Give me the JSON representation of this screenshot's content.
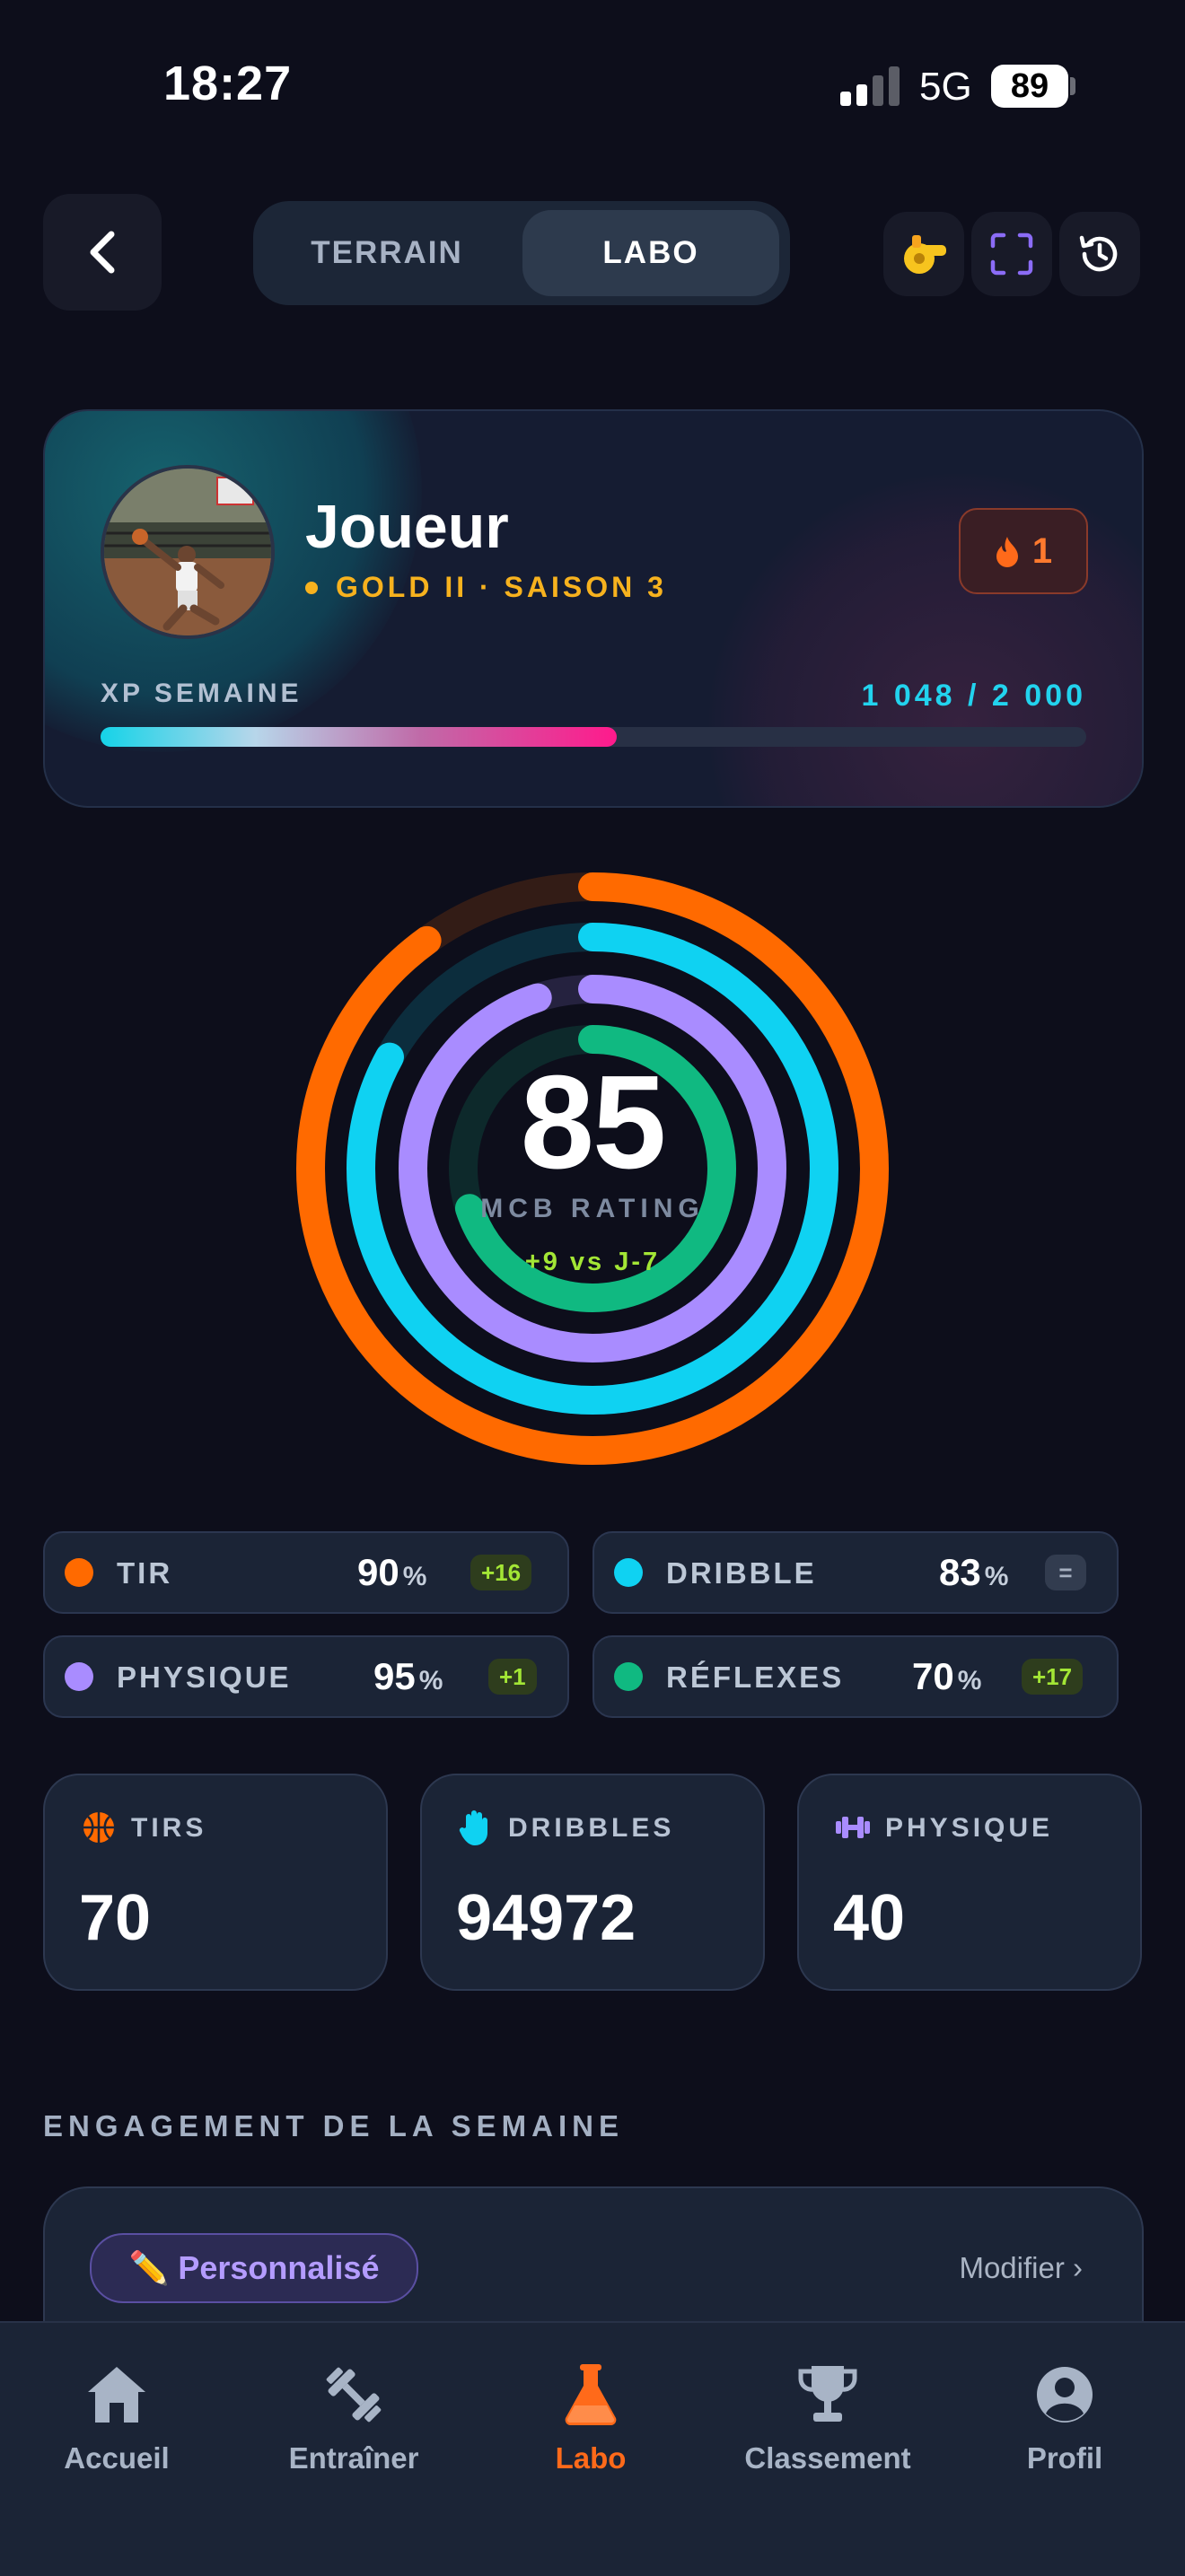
{
  "status_bar": {
    "time": "18:27",
    "network": "5G",
    "battery": "89"
  },
  "top_nav": {
    "tabs": [
      {
        "label": "TERRAIN"
      },
      {
        "label": "LABO"
      }
    ],
    "active_tab": "LABO"
  },
  "player": {
    "name": "Joueur",
    "rank": "GOLD II · SAISON 3",
    "streak": "1",
    "xp_label": "XP SEMAINE",
    "xp_value": "1 048 / 2 000",
    "xp_progress": 0.524
  },
  "rating": {
    "value": "85",
    "label": "MCB RATING",
    "delta": "+9 vs J-7",
    "rings": [
      {
        "name": "tir",
        "value": 0.9,
        "color": "#ff6a00"
      },
      {
        "name": "dribble",
        "value": 0.83,
        "color": "#0fd2f2"
      },
      {
        "name": "physique",
        "value": 0.95,
        "color": "#a98cff"
      },
      {
        "name": "reflexes",
        "value": 0.7,
        "color": "#10b981"
      }
    ]
  },
  "stats": [
    {
      "name": "TIR",
      "value": "90",
      "unit": "%",
      "delta": "+16",
      "color": "#ff6a00"
    },
    {
      "name": "DRIBBLE",
      "value": "83",
      "unit": "%",
      "delta": "=",
      "color": "#0fd2f2"
    },
    {
      "name": "PHYSIQUE",
      "value": "95",
      "unit": "%",
      "delta": "+1",
      "color": "#a98cff"
    },
    {
      "name": "RÉFLEXES",
      "value": "70",
      "unit": "%",
      "delta": "+17",
      "color": "#10b981"
    }
  ],
  "metrics": [
    {
      "title": "TIRS",
      "value": "70",
      "icon": "basketball-icon",
      "color": "#ff6a00"
    },
    {
      "title": "DRIBBLES",
      "value": "94972",
      "icon": "hand-icon",
      "color": "#0fd2f2"
    },
    {
      "title": "PHYSIQUE",
      "value": "40",
      "icon": "dumbbell-icon",
      "color": "#a98cff"
    }
  ],
  "engagement": {
    "title": "ENGAGEMENT DE LA SEMAINE",
    "tag": "Personnalisé",
    "tag_icon": "✏️",
    "modify": "Modifier ›"
  },
  "tabbar": {
    "items": [
      {
        "label": "Accueil",
        "icon": "home-icon"
      },
      {
        "label": "Entraîner",
        "icon": "dumbbell-icon"
      },
      {
        "label": "Labo",
        "icon": "flask-icon"
      },
      {
        "label": "Classement",
        "icon": "trophy-icon"
      },
      {
        "label": "Profil",
        "icon": "profile-icon"
      }
    ],
    "active": "Labo"
  },
  "colors": {
    "background": "#0d0e1b",
    "accent": "#ff6a1a",
    "gold": "#f7b21e",
    "lime": "#a3e635",
    "cyan": "#22d3ee"
  }
}
